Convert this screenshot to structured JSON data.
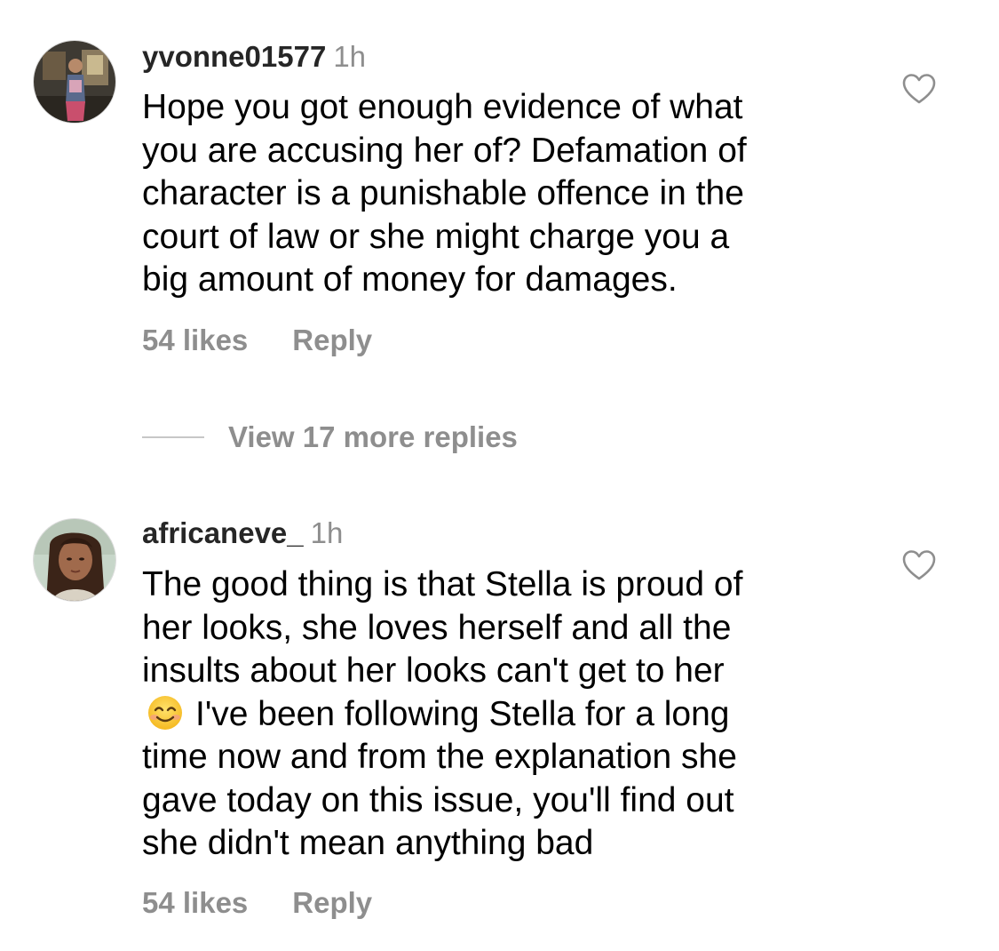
{
  "comments": [
    {
      "username": "yvonne01577",
      "time": "1h",
      "text_lines": [
        "Hope you got enough evidence of what",
        "you are accusing her of? Defamation of",
        "character is a punishable offence in the",
        "court of law or she might charge you a",
        "big amount of money for damages."
      ],
      "likes": "54 likes",
      "reply_label": "Reply",
      "avatar_icon": "profile-photo",
      "like_icon": "heart-outline-icon"
    },
    {
      "username": "africaneve_",
      "time": "1h",
      "text_lines": [
        "The good thing is that Stella is proud of",
        "her looks, she loves herself and all the",
        "insults about her looks can't get to her",
        "I've been following Stella for a long",
        "time now and from the explanation she",
        "gave today on this issue, you'll find out",
        "she didn't mean anything bad"
      ],
      "emoji": "smiling-face-emoji",
      "likes": "54 likes",
      "reply_label": "Reply",
      "avatar_icon": "profile-photo",
      "like_icon": "heart-outline-icon"
    }
  ],
  "view_replies": {
    "label": "View 17 more replies"
  },
  "colors": {
    "text": "#000000",
    "secondary": "#8e8e8e",
    "divider": "#c7c7c7"
  }
}
